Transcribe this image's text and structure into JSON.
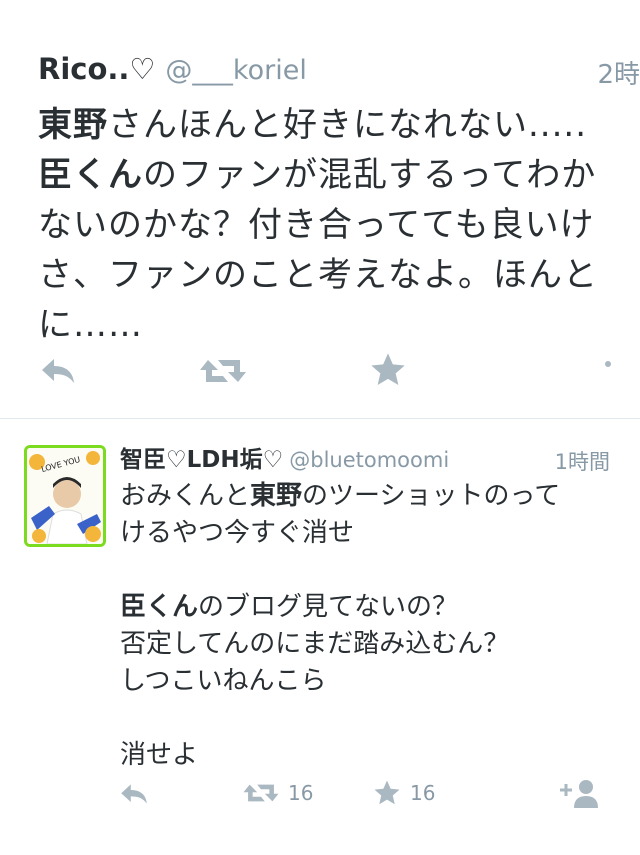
{
  "tweet1": {
    "name": "Rico..♡",
    "handle": "@___koriel",
    "time": "2時",
    "lines": [
      {
        "bold": "東野",
        "text": "さんほんと好きになれない....."
      },
      {
        "bold": "臣くん",
        "text": "のファンが混乱するってわか"
      },
      {
        "bold": "",
        "text": "ないのかな？付き合ってても良いけ"
      },
      {
        "bold": "",
        "text": "さ、ファンのこと考えなよ。ほんと"
      },
      {
        "bold": "",
        "text": "に……"
      }
    ]
  },
  "tweet2": {
    "name": "智臣♡LDH垢♡",
    "handle": "@bluetomoomi",
    "time": "1時間",
    "avatar_text": "LOVE YOU",
    "line1_pre": "おみくんと",
    "line1_bold": "東野",
    "line1_post": "のツーショットのって",
    "line2": "けるやつ今すぐ消せ",
    "line3_bold": "臣くん",
    "line3_post": "のブログ見てないの？",
    "line4": "否定してんのにまだ踏み込むん？",
    "line5": "しつこいねんこら",
    "line6": "消せよ",
    "retweets": "16",
    "favorites": "16"
  },
  "colors": {
    "text": "#292f33",
    "muted": "#8899a6",
    "icon": "#aab8c2",
    "divider": "#e1e8ed",
    "avatar_border": "#7bdc1f"
  }
}
